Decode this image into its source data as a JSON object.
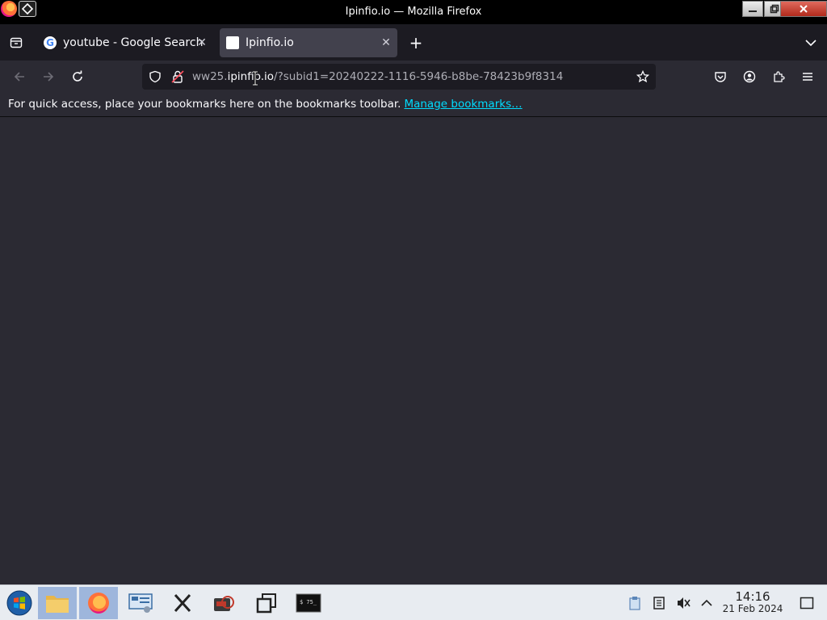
{
  "window": {
    "title": "Ipinfio.io — Mozilla Firefox",
    "controls": {
      "minimize": "minimize",
      "restore": "restore",
      "close": "close"
    }
  },
  "tabs": [
    {
      "label": "youtube - Google Search",
      "favicon": "google-g-icon",
      "active": false
    },
    {
      "label": "Ipinfio.io",
      "favicon": "blank-page-icon",
      "active": true
    }
  ],
  "tabstrip": {
    "new_tab": "+",
    "list_all_tabs": "chevron-down-icon"
  },
  "toolbar": {
    "url_prefix": "ww25.",
    "url_host": "ipinfio.io",
    "url_rest": "/?subid1=20240222-1116-5946-b8be-78423b9f8314",
    "back_disabled": true,
    "forward_disabled": true
  },
  "bookmarks_bar": {
    "message": "For quick access, place your bookmarks here on the bookmarks toolbar.",
    "link": "Manage bookmarks…"
  },
  "taskbar": {
    "apps": [
      "start-menu",
      "file-manager",
      "firefox",
      "system-settings",
      "xorg-app",
      "media-app",
      "window-switcher",
      "terminal"
    ],
    "active_app": "firefox",
    "time": "14:16",
    "date": "21 Feb 2024"
  },
  "colors": {
    "chrome_dark": "#1c1b22",
    "toolbar": "#2b2a33",
    "active_tab": "#42414d",
    "link": "#00ddff",
    "taskbar": "#e8ecf1"
  }
}
